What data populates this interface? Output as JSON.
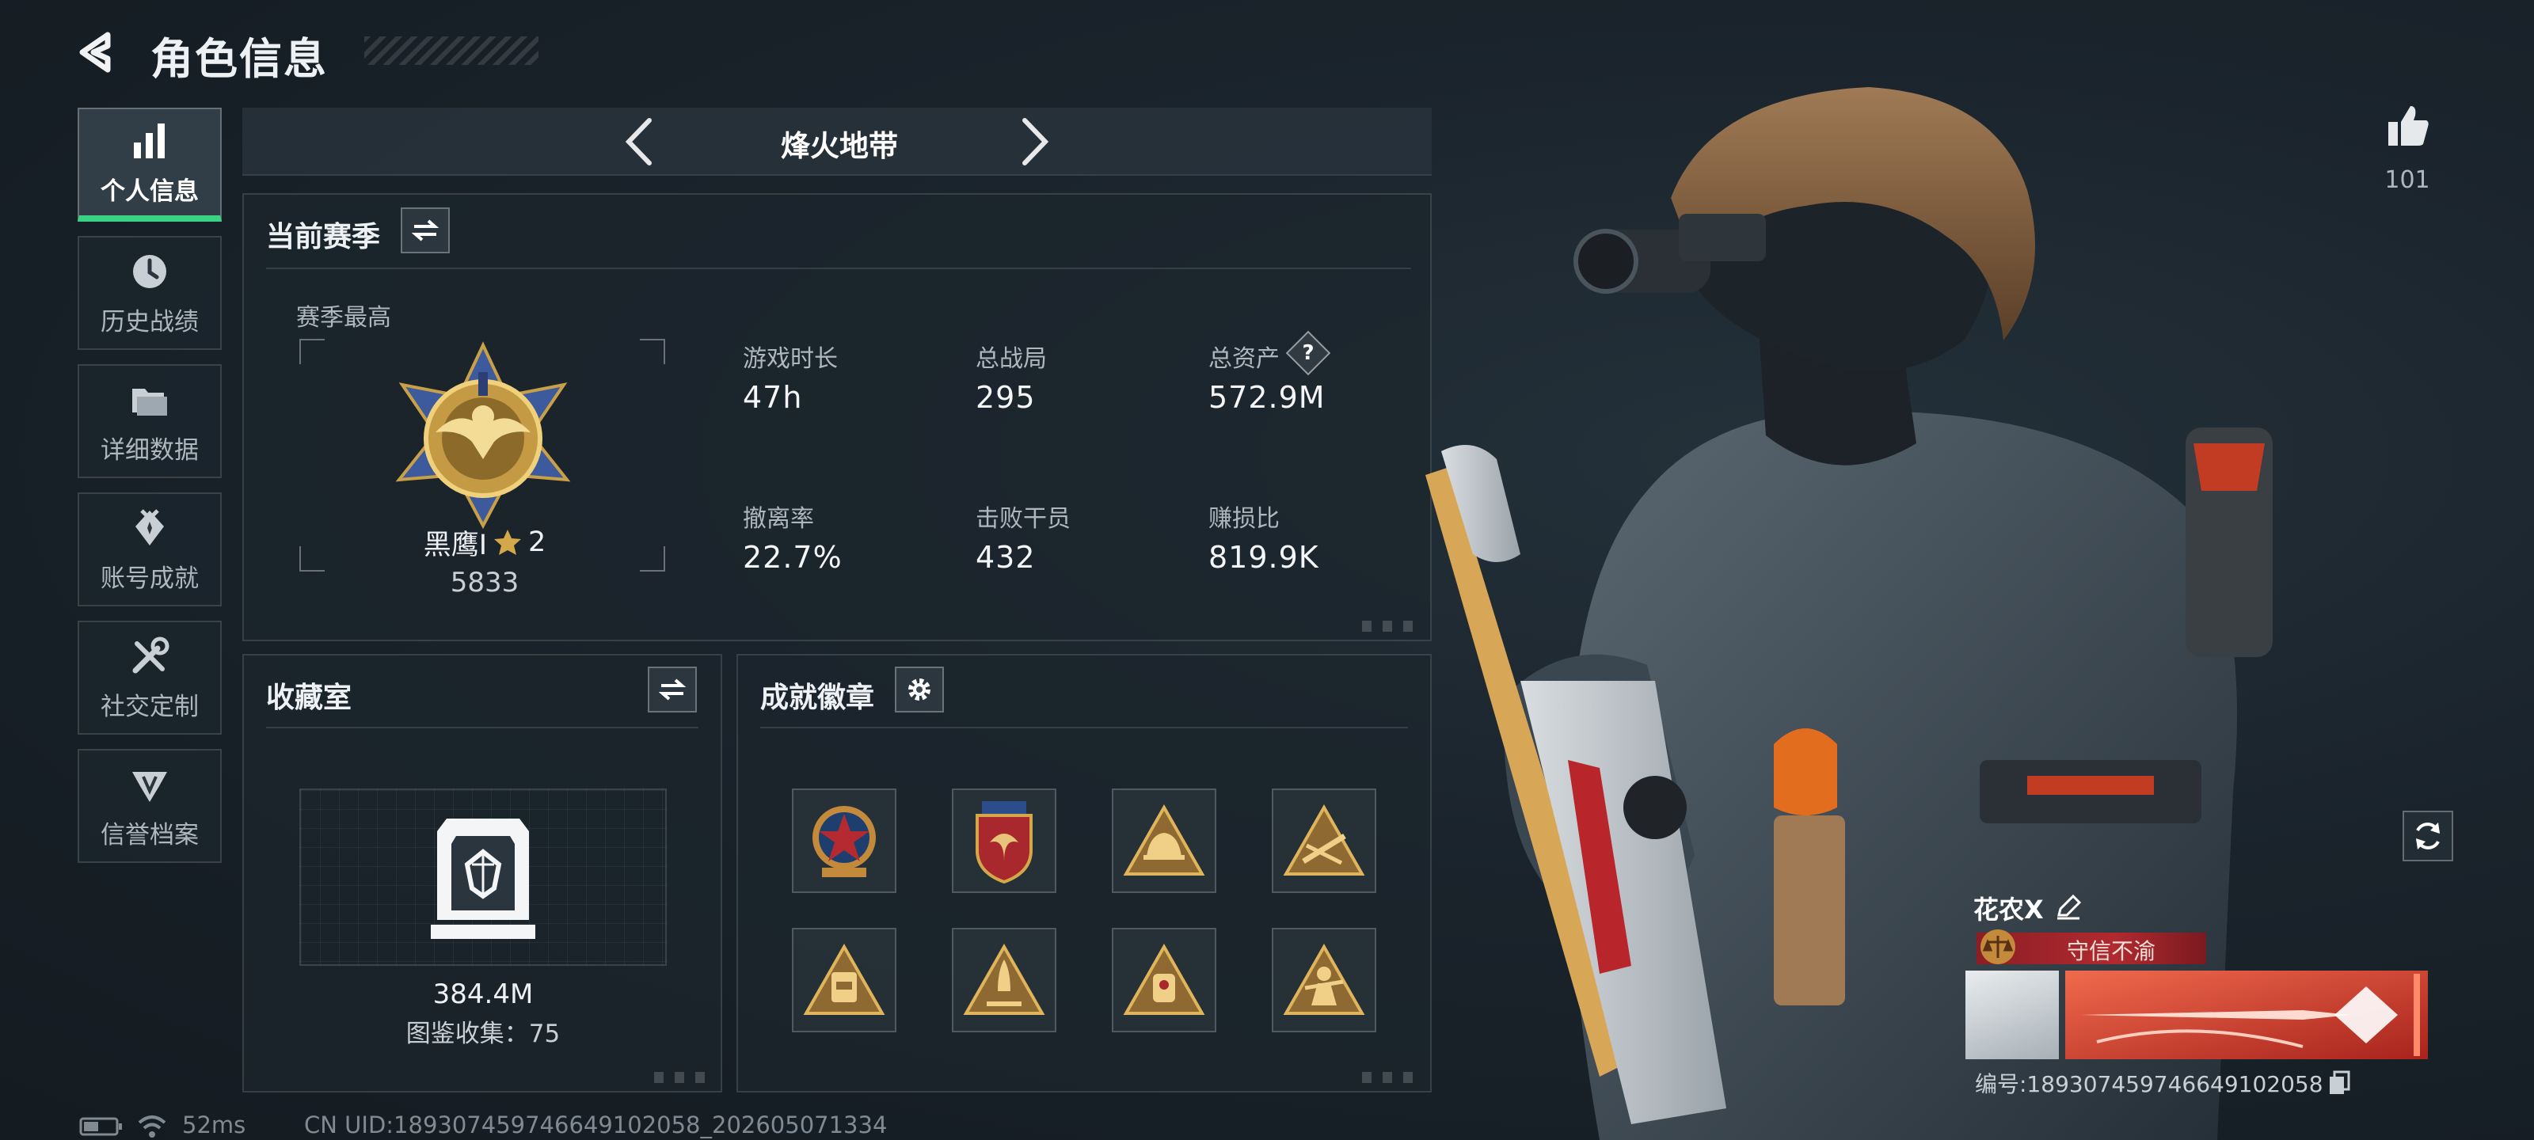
{
  "header": {
    "title": "角色信息"
  },
  "nav": {
    "items": [
      {
        "label": "个人信息",
        "icon": "bar-chart-icon",
        "active": true
      },
      {
        "label": "历史战绩",
        "icon": "clock-icon",
        "active": false
      },
      {
        "label": "详细数据",
        "icon": "folder-icon",
        "active": false
      },
      {
        "label": "账号成就",
        "icon": "achievement-icon",
        "active": false
      },
      {
        "label": "社交定制",
        "icon": "tools-icon",
        "active": false
      },
      {
        "label": "信誉档案",
        "icon": "reputation-icon",
        "active": false
      }
    ]
  },
  "mode": {
    "name": "烽火地带"
  },
  "season": {
    "title": "当前赛季",
    "best_label": "赛季最高",
    "rank_name": "黑鹰I",
    "rank_stars": "2",
    "rank_score": "5833",
    "stats": [
      {
        "label": "游戏时长",
        "value": "47h"
      },
      {
        "label": "总战局",
        "value": "295"
      },
      {
        "label": "总资产",
        "value": "572.9M",
        "help": "?"
      },
      {
        "label": "撤离率",
        "value": "22.7%"
      },
      {
        "label": "击败干员",
        "value": "432"
      },
      {
        "label": "赚损比",
        "value": "819.9K"
      }
    ]
  },
  "collection": {
    "title": "收藏室",
    "value": "384.4M",
    "catalog_label": "图鉴收集：75"
  },
  "badges": {
    "title": "成就徽章",
    "items": [
      "star-shield-badge-icon",
      "eagle-shield-badge-icon",
      "helmet-triangle-badge-icon",
      "rifle-triangle-badge-icon",
      "backpack-triangle-badge-icon",
      "rocket-triangle-badge-icon",
      "robot-triangle-badge-icon",
      "soldier-triangle-badge-icon"
    ]
  },
  "profile": {
    "likes": "101",
    "player_name": "花农X",
    "title_tag": "守信不渝",
    "player_id": "编号:1893074597466491020­58"
  },
  "footer": {
    "ping": "52ms",
    "uid": "CN UID:1893074597466491020­58_202605071334"
  },
  "colors": {
    "accent_green": "#39d483",
    "title_red": "#a3222a",
    "gold": "#d4a849",
    "nameplate_red": "#e0452f"
  }
}
